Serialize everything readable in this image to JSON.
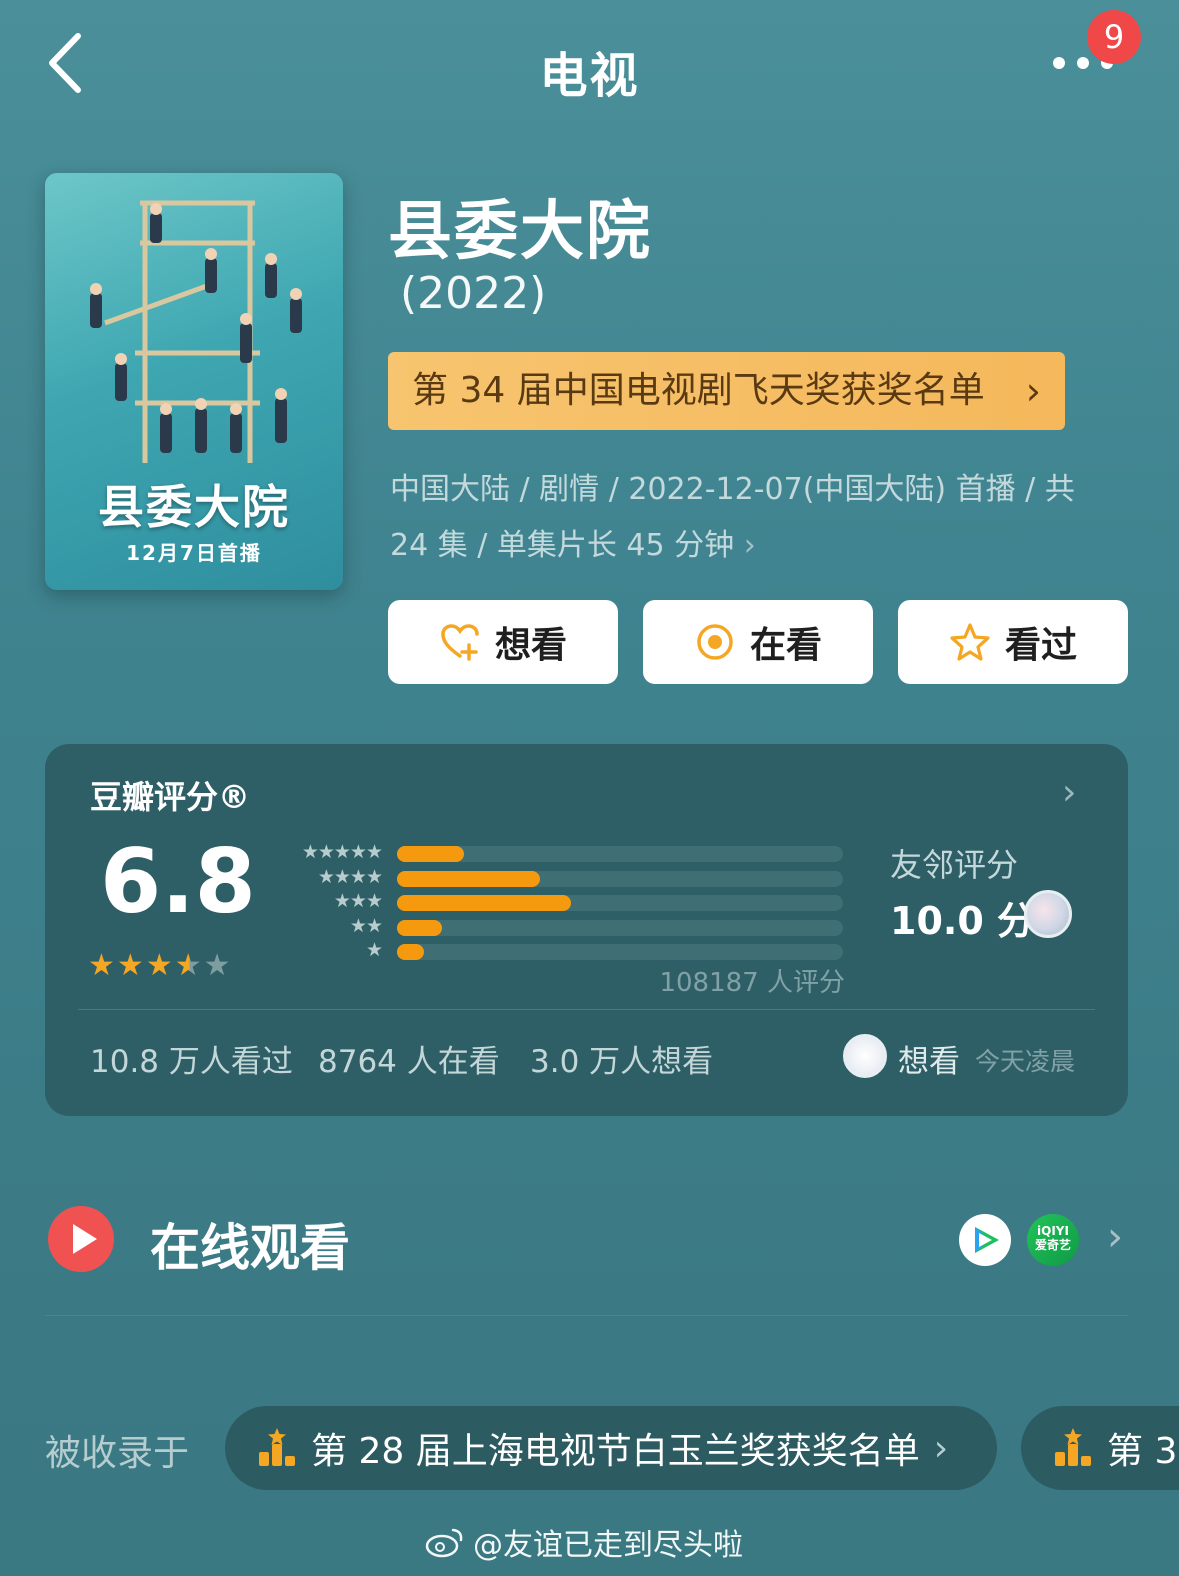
{
  "nav": {
    "title": "电视",
    "notification_count": "9"
  },
  "poster": {
    "title": "县委大院",
    "date": "12月7日首播"
  },
  "show": {
    "title": "县委大院",
    "year": "(2022)",
    "award_banner": "第 34 届中国电视剧飞天奖获奖名单",
    "meta_line1": "中国大陆 / 剧情 / 2022-12-07(中国大陆) 首播 / 共",
    "meta_line2": "24 集 / 单集片长 45 分钟"
  },
  "actions": {
    "want": "想看",
    "watching": "在看",
    "watched": "看过"
  },
  "rating": {
    "label": "豆瓣评分®",
    "score": "6.8",
    "stars_value": 3.5,
    "distribution": [
      {
        "stars": "★★★★★",
        "fraction": 0.15
      },
      {
        "stars": "★★★★",
        "fraction": 0.32
      },
      {
        "stars": "★★★",
        "fraction": 0.39
      },
      {
        "stars": "★★",
        "fraction": 0.1
      },
      {
        "stars": "★",
        "fraction": 0.06
      }
    ],
    "count": "108187 人评分",
    "friend_label": "友邻评分",
    "friend_score": "10.0 分"
  },
  "stats": {
    "watched": "10.8 万人看过",
    "watching": "8764 人在看",
    "want": "3.0 万人想看",
    "recent_action": "想看",
    "recent_time": "今天凌晨"
  },
  "online": {
    "label": "在线观看",
    "iqiyi_text": "iQIYI",
    "iqiyi_sub": "爱奇艺"
  },
  "collected": {
    "label": "被收录于",
    "items": [
      "第 28 届上海电视节白玉兰奖获奖名单",
      "第 3"
    ]
  },
  "watermark": "@友谊已走到尽头啦",
  "colors": {
    "accent_orange": "#f59a0f",
    "banner": "#f5b85b",
    "badge": "#f04848"
  }
}
